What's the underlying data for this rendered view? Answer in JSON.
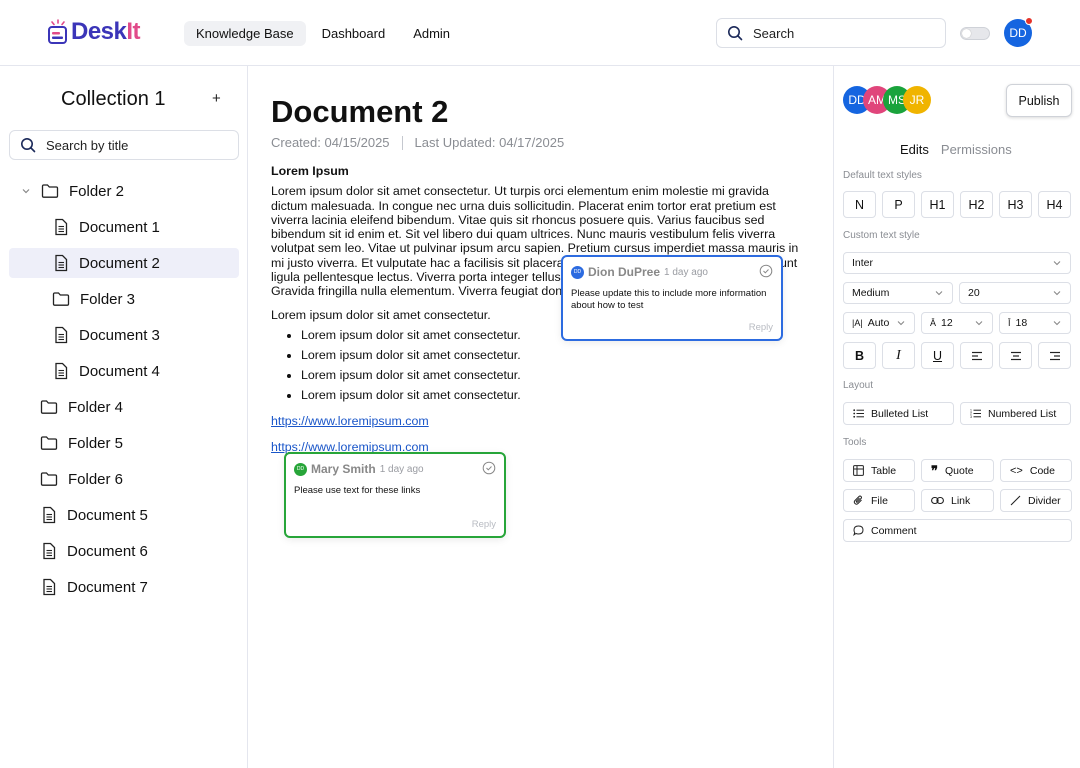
{
  "header": {
    "logo_text_1": "Desk",
    "logo_text_2": "It",
    "nav": [
      "Knowledge Base",
      "Dashboard",
      "Admin"
    ],
    "search_placeholder": "Search",
    "user_initials": "DD"
  },
  "sidebar": {
    "title": "Collection 1",
    "add": "+",
    "search_placeholder": "Search by title",
    "items": [
      {
        "label": "Folder 2",
        "type": "folder",
        "expanded": true
      },
      {
        "label": "Document 1",
        "type": "doc"
      },
      {
        "label": "Document 2",
        "type": "doc",
        "active": true
      },
      {
        "label": "Folder 3",
        "type": "folder"
      },
      {
        "label": "Document 3",
        "type": "doc"
      },
      {
        "label": "Document 4",
        "type": "doc"
      },
      {
        "label": "Folder 4",
        "type": "folder"
      },
      {
        "label": "Folder 5",
        "type": "folder"
      },
      {
        "label": "Folder 6",
        "type": "folder"
      },
      {
        "label": "Document 5",
        "type": "doc"
      },
      {
        "label": "Document 6",
        "type": "doc"
      },
      {
        "label": "Document 7",
        "type": "doc"
      }
    ]
  },
  "document": {
    "title": "Document 2",
    "created": "Created: 04/15/2025",
    "updated": "Last Updated: 04/17/2025",
    "heading": "Lorem Ipsum",
    "paragraph": "Lorem ipsum dolor sit amet consectetur. Ut turpis orci elementum enim molestie mi gravida dictum malesuada. In congue nec urna duis sollicitudin. Placerat enim tortor erat pretium est viverra lacinia eleifend bibendum. Vitae quis sit rhoncus posuere quis. Varius faucibus sed bibendum sit id enim et. Sit vel libero dui quam ultrices. Nunc mauris vestibulum felis viverra volutpat sem leo. Vitae ut pulvinar ipsum arcu sapien. Pretium cursus imperdiet massa mauris in mi justo viverra. Et vulputate hac a facilisis sit placerat. Vestibulum tincidunt eget ac vel tincidunt ligula pellentesque lectus. Viverra porta integer tellus pellentesque lorem turpis tempus et. Gravida fringilla nulla elementum. Viverra feugiat donec sit turpis rhoncus.",
    "intro": "Lorem ipsum dolor sit amet consectetur.",
    "bullets": [
      "Lorem ipsum dolor sit amet consectetur.",
      "Lorem ipsum dolor sit amet consectetur.",
      "Lorem ipsum dolor sit amet consectetur.",
      "Lorem ipsum dolor sit amet consectetur."
    ],
    "links": [
      "https://www.loremipsum.com",
      "https://www.loremipsum.com"
    ]
  },
  "comments": [
    {
      "initials": "DD",
      "author": "Dion DuPree",
      "time": "1 day ago",
      "text": "Please update this to include more information about how to test",
      "reply": "Reply",
      "color": "#2c6be0"
    },
    {
      "initials": "DD",
      "author": "Mary Smith",
      "time": "1 day ago",
      "text": "Please use text for these links",
      "reply": "Reply",
      "color": "#27a539"
    }
  ],
  "panel": {
    "collaborators": [
      {
        "initials": "DD",
        "color": "#1565e0"
      },
      {
        "initials": "AM",
        "color": "#e0457b"
      },
      {
        "initials": "MS",
        "color": "#1aa33c"
      },
      {
        "initials": "JR",
        "color": "#f0b400"
      }
    ],
    "publish": "Publish",
    "tabs": [
      "Edits",
      "Permissions"
    ],
    "default_styles_label": "Default text styles",
    "default_styles": [
      "N",
      "P",
      "H1",
      "H2",
      "H3",
      "H4"
    ],
    "custom_style_label": "Custom text style",
    "font": "Inter",
    "weight": "Medium",
    "size": "20",
    "letter_spacing": "Auto",
    "font_size": "12",
    "line_height": "18",
    "layout_label": "Layout",
    "layout": [
      "Bulleted List",
      "Numbered List"
    ],
    "tools_label": "Tools",
    "tools": [
      "Table",
      "Quote",
      "Code",
      "File",
      "Link",
      "Divider",
      "Comment"
    ]
  }
}
